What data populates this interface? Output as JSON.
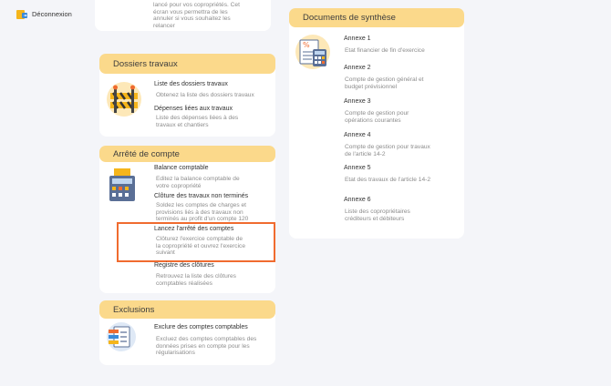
{
  "header": {
    "logout_label": "Déconnexion"
  },
  "top_card": {
    "text": "lancé pour vos copropriétés. Cet écran vous permettra de les annuler si vous souhaitez les relancer"
  },
  "dossiers": {
    "title": "Dossiers travaux",
    "items": [
      {
        "title": "Liste des dossiers travaux",
        "desc": "Obtenez la liste des dossiers travaux"
      },
      {
        "title": "Dépenses liées aux travaux",
        "desc": "Liste des dépenses liées à des travaux et chantiers"
      }
    ]
  },
  "arrete": {
    "title": "Arrêté de compte",
    "items": [
      {
        "title": "Balance comptable",
        "desc": "Editez la balance comptable de votre copropriété"
      },
      {
        "title": "Clôture des travaux non terminés",
        "desc": "Soldez les comptes de charges et provisions liés à des travaux non terminés au profit d'un compte 120"
      },
      {
        "title": "Lancez l'arrêté des comptes",
        "desc": "Clôturez l'exercice comptable de la copropriété et ouvrez l'exercice suivant"
      },
      {
        "title": "Registre des clôtures",
        "desc": "Retrouvez la liste des clôtures comptables réalisées"
      }
    ]
  },
  "exclusions": {
    "title": "Exclusions",
    "items": [
      {
        "title": "Exclure des comptes comptables",
        "desc": "Excluez des comptes comptables des données prises en compte pour les régularisations"
      }
    ]
  },
  "synthese": {
    "title": "Documents de synthèse",
    "items": [
      {
        "title": "Annexe 1",
        "desc": "Etat financier de fin d'exercice"
      },
      {
        "title": "Annexe 2",
        "desc": "Compte de gestion général et budget prévisionnel"
      },
      {
        "title": "Annexe 3",
        "desc": "Compte de gestion pour opérations courantes"
      },
      {
        "title": "Annexe 4",
        "desc": "Compte de gestion pour travaux de l'article 14-2"
      },
      {
        "title": "Annexe 5",
        "desc": "Etat des travaux de l'article 14-2"
      },
      {
        "title": "Annexe 6",
        "desc": "Liste des copropriétaires créditeurs et débiteurs"
      }
    ]
  },
  "colors": {
    "header_bg": "#fbd98b",
    "highlight": "#f06b2f"
  }
}
